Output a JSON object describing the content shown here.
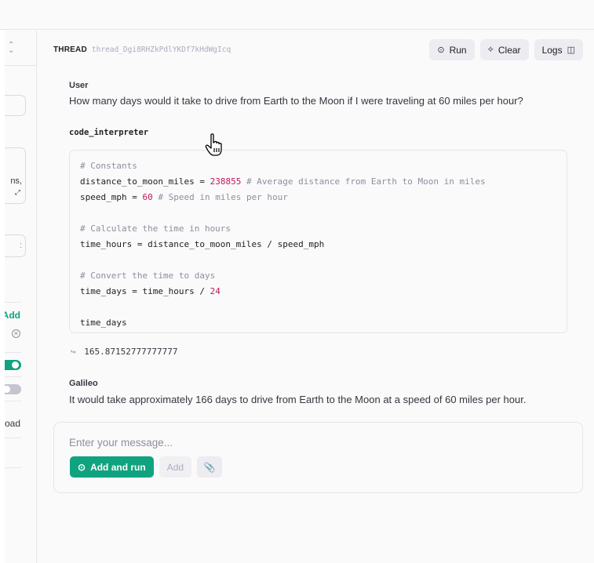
{
  "sidebar": {
    "box2_text": "ns,",
    "box3_text": ":",
    "add_label": "Add",
    "upload_label": "load",
    "toggles": [
      {
        "name": "toggle-1",
        "on": true
      },
      {
        "name": "toggle-2",
        "on": false
      }
    ]
  },
  "thread": {
    "label": "THREAD",
    "id": "thread_Dgi8RHZkPdlYKDf7kHdWgIcq"
  },
  "header_actions": {
    "run_label": "Run",
    "clear_label": "Clear",
    "logs_label": "Logs"
  },
  "messages": {
    "user_role": "User",
    "user_text": "How many days would it take to drive from Earth to the Moon if I were traveling at 60 miles per hour?",
    "tool_name": "code_interpreter",
    "code_lines": [
      [
        {
          "t": "c",
          "v": "# Constants"
        }
      ],
      [
        {
          "t": "p",
          "v": "distance_to_moon_miles = "
        },
        {
          "t": "n",
          "v": "238855"
        },
        {
          "t": "c",
          "v": " # Average distance from Earth to Moon in miles"
        }
      ],
      [
        {
          "t": "p",
          "v": "speed_mph = "
        },
        {
          "t": "n",
          "v": "60"
        },
        {
          "t": "c",
          "v": " # Speed in miles per hour"
        }
      ],
      [],
      [
        {
          "t": "c",
          "v": "# Calculate the time in hours"
        }
      ],
      [
        {
          "t": "p",
          "v": "time_hours = distance_to_moon_miles / speed_mph"
        }
      ],
      [],
      [
        {
          "t": "c",
          "v": "# Convert the time to days"
        }
      ],
      [
        {
          "t": "p",
          "v": "time_days = time_hours / "
        },
        {
          "t": "n",
          "v": "24"
        }
      ],
      [],
      [
        {
          "t": "p",
          "v": "time_days"
        }
      ]
    ],
    "output_arrow": "↪",
    "output_value": "165.87152777777777",
    "assistant_role": "Galileo",
    "assistant_text": "It would take approximately 166 days to drive from Earth to the Moon at a speed of 60 miles per hour."
  },
  "composer": {
    "placeholder": "Enter your message...",
    "value": "",
    "add_and_run_label": "Add and run",
    "add_label": "Add"
  },
  "colors": {
    "accent": "#10a37f",
    "code_number": "#c2185b",
    "code_comment": "#8e8ea0"
  }
}
